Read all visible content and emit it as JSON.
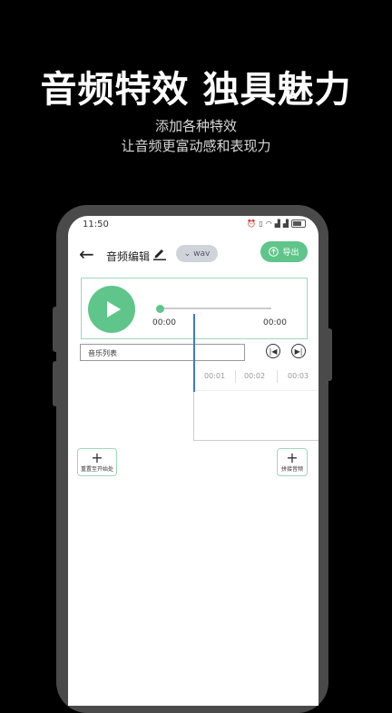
{
  "promo": {
    "headline": "音频特效 独具魅力",
    "line1": "添加各种特效",
    "line2": "让音频更富动感和表现力"
  },
  "status_bar": {
    "time": "11:50",
    "icons": [
      "alarm-icon",
      "vibrate-icon",
      "wifi-icon",
      "signal-icon",
      "signal-icon",
      "battery-icon"
    ]
  },
  "appbar": {
    "title": "音频编辑",
    "format": "wav",
    "export_label": "导出"
  },
  "player": {
    "current_time": "00:00",
    "total_time": "00:00",
    "progress": 0
  },
  "music_list": {
    "label": "音乐列表"
  },
  "timeline": {
    "ticks": [
      "00:01",
      "00:02",
      "00:03"
    ]
  },
  "buttons": {
    "add_left_label": "重置至开始处",
    "add_right_label": "拼接音频"
  },
  "colors": {
    "accent": "#5fc58a",
    "playhead": "#3a7bd5"
  }
}
